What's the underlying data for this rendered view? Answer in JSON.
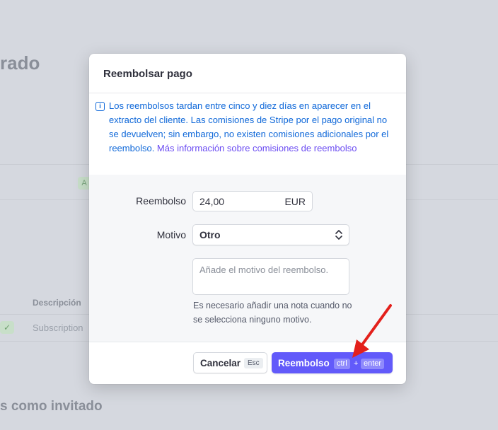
{
  "background": {
    "title": "rado",
    "badge_letter": "A",
    "table_header": "Descripción",
    "row_check": "✓",
    "row_description": "Subscription",
    "guest_heading": "s como invitado"
  },
  "modal": {
    "title": "Reembolsar pago",
    "notice": {
      "icon": "info-icon",
      "text": "Los reembolsos tardan entre cinco y diez días en aparecer en el extracto del cliente. Las comisiones de Stripe por el pago original no se devuelven; sin embargo, no existen comisiones adicionales por el reembolso. ",
      "link": "Más información sobre comisiones de reembolso",
      "text_color": "#0f68d9",
      "link_color": "#6b4cf2"
    },
    "form": {
      "amount_label": "Reembolso",
      "amount_value": "24,00",
      "amount_currency": "EUR",
      "reason_label": "Motivo",
      "reason_value": "Otro",
      "note_placeholder": "Añade el motivo del reembolso.",
      "hint": "Es necesario añadir una nota cuando no se selecciona ninguno motivo."
    },
    "footer": {
      "cancel_label": "Cancelar",
      "cancel_shortcut": "Esc",
      "refund_label": "Reembolso",
      "refund_shortcut_key1": "ctrl",
      "refund_shortcut_plus": "+",
      "refund_shortcut_key2": "enter",
      "primary_color": "#625afa"
    }
  },
  "annotation": {
    "arrow_color": "#e3201b"
  }
}
